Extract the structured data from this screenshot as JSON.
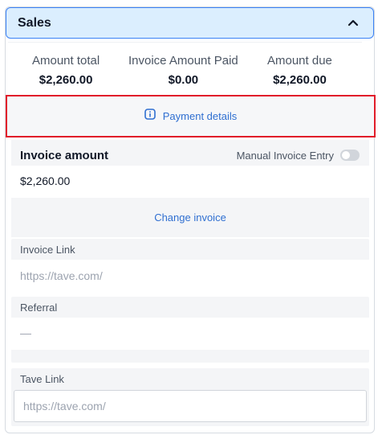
{
  "header": {
    "title": "Sales"
  },
  "summary": {
    "amount_total": {
      "label": "Amount total",
      "value": "$2,260.00"
    },
    "invoice_paid": {
      "label": "Invoice Amount Paid",
      "value": "$0.00"
    },
    "amount_due": {
      "label": "Amount due",
      "value": "$2,260.00"
    }
  },
  "payment_details": {
    "label": "Payment details"
  },
  "invoice": {
    "title": "Invoice amount",
    "manual_entry_label": "Manual Invoice Entry",
    "manual_entry_enabled": false,
    "value": "$2,260.00",
    "change_link": "Change invoice"
  },
  "invoice_link": {
    "label": "Invoice Link",
    "placeholder": "https://tave.com/"
  },
  "referral": {
    "label": "Referral",
    "value": "—"
  },
  "tave_link": {
    "label": "Tave Link",
    "placeholder": "https://tave.com/"
  },
  "colors": {
    "accent": "#2f6fd1",
    "header_bg": "#dbeefe",
    "highlight_border": "#e11d2a"
  }
}
